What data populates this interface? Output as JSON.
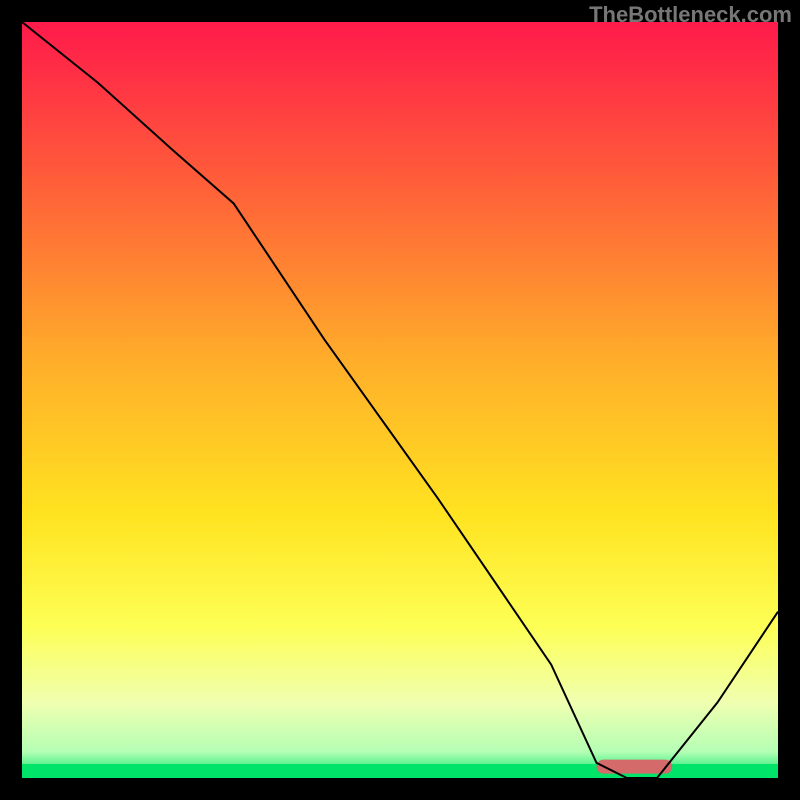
{
  "watermark": "TheBottleneck.com",
  "chart_data": {
    "type": "line",
    "title": "",
    "xlabel": "",
    "ylabel": "",
    "xlim": [
      0,
      100
    ],
    "ylim": [
      0,
      100
    ],
    "background": {
      "type": "vertical_gradient",
      "stops": [
        {
          "pos": 0.0,
          "color": "#ff1a4b"
        },
        {
          "pos": 0.2,
          "color": "#ff5a3a"
        },
        {
          "pos": 0.45,
          "color": "#ffae2a"
        },
        {
          "pos": 0.65,
          "color": "#ffe320"
        },
        {
          "pos": 0.8,
          "color": "#fdff55"
        },
        {
          "pos": 0.9,
          "color": "#f0ffb0"
        },
        {
          "pos": 0.965,
          "color": "#b5ffb5"
        },
        {
          "pos": 1.0,
          "color": "#00e46a"
        }
      ]
    },
    "series": [
      {
        "name": "curve",
        "color": "#000000",
        "width": 2,
        "x": [
          0,
          10,
          20,
          28,
          40,
          55,
          70,
          76,
          80,
          84,
          92,
          100
        ],
        "y": [
          100,
          92,
          83,
          76,
          58,
          37,
          15,
          2,
          0,
          0,
          10,
          22
        ]
      }
    ],
    "markers": [
      {
        "name": "optimal-bar",
        "shape": "rounded_rect",
        "x0": 76,
        "x1": 86,
        "y": 1.5,
        "color": "#d46a6a"
      }
    ]
  }
}
